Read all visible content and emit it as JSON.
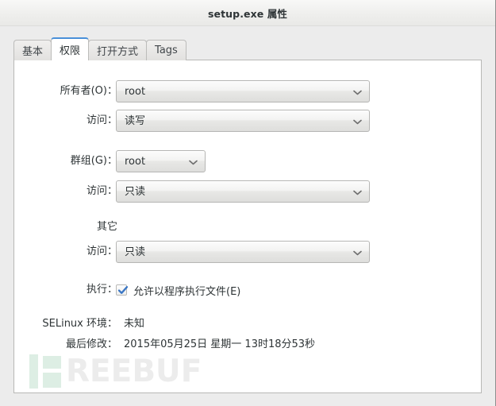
{
  "window": {
    "title": "setup.exe 属性"
  },
  "tabs": [
    {
      "label": "基本",
      "active": false
    },
    {
      "label": "权限",
      "active": true
    },
    {
      "label": "打开方式",
      "active": false
    },
    {
      "label": "Tags",
      "active": false
    }
  ],
  "permissions": {
    "owner": {
      "label": "所有者(O)：",
      "value": "root",
      "control": "dropdown"
    },
    "owner_access": {
      "label": "访问：",
      "value": "读写",
      "control": "dropdown"
    },
    "group": {
      "label": "群组(G)：",
      "value": "root",
      "control": "dropdown"
    },
    "group_access": {
      "label": "访问：",
      "value": "只读",
      "control": "dropdown"
    },
    "others_heading": "其它",
    "others_access": {
      "label": "访问：",
      "value": "只读",
      "control": "dropdown"
    },
    "execute": {
      "label": "执行：",
      "checkbox_label": "允许以程序执行文件(E)",
      "checked": true
    },
    "selinux": {
      "label": "SELinux 环境：",
      "value": "未知"
    },
    "last_modified": {
      "label": "最后修改：",
      "value": "2015年05月25日 星期一 13时18分53秒"
    }
  },
  "watermark": {
    "text": "REEBUF",
    "mark_color": "#ddeee4",
    "text_color": "#ececec"
  },
  "colors": {
    "accent": "#4a90d9",
    "window_bg": "#ececec",
    "panel_bg": "#ffffff",
    "text": "#2e3436"
  }
}
